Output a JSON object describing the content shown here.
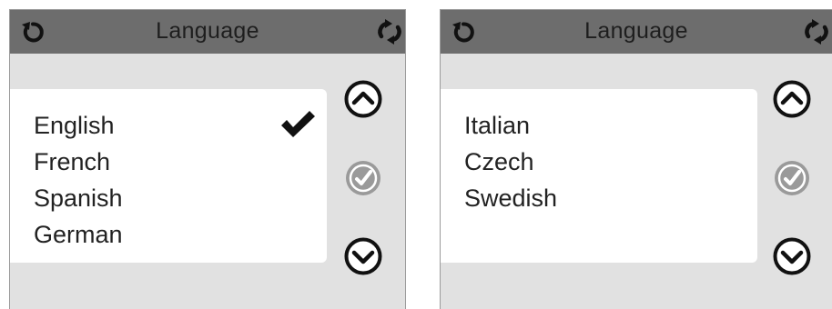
{
  "screens": [
    {
      "header": {
        "title": "Language",
        "back_icon": "back-arrow-icon",
        "refresh_icon": "refresh-icon"
      },
      "items": [
        {
          "label": "English",
          "selected": true
        },
        {
          "label": "French",
          "selected": false
        },
        {
          "label": "Spanish",
          "selected": false
        },
        {
          "label": "German",
          "selected": false
        }
      ],
      "buttons": {
        "up_icon": "chevron-up-icon",
        "select_icon": "check-circle-icon",
        "select_enabled": false,
        "down_icon": "chevron-down-icon"
      }
    },
    {
      "header": {
        "title": "Language",
        "back_icon": "back-arrow-icon",
        "refresh_icon": "refresh-icon"
      },
      "items": [
        {
          "label": "Italian",
          "selected": false
        },
        {
          "label": "Czech",
          "selected": false
        },
        {
          "label": "Swedish",
          "selected": false
        }
      ],
      "buttons": {
        "up_icon": "chevron-up-icon",
        "select_icon": "check-circle-icon",
        "select_enabled": false,
        "down_icon": "chevron-down-icon"
      }
    }
  ],
  "colors": {
    "header_bg": "#6d6d6d",
    "body_bg": "#e1e1e1",
    "list_bg": "#ffffff",
    "text": "#222222",
    "disabled_button": "#9a9a9a"
  }
}
